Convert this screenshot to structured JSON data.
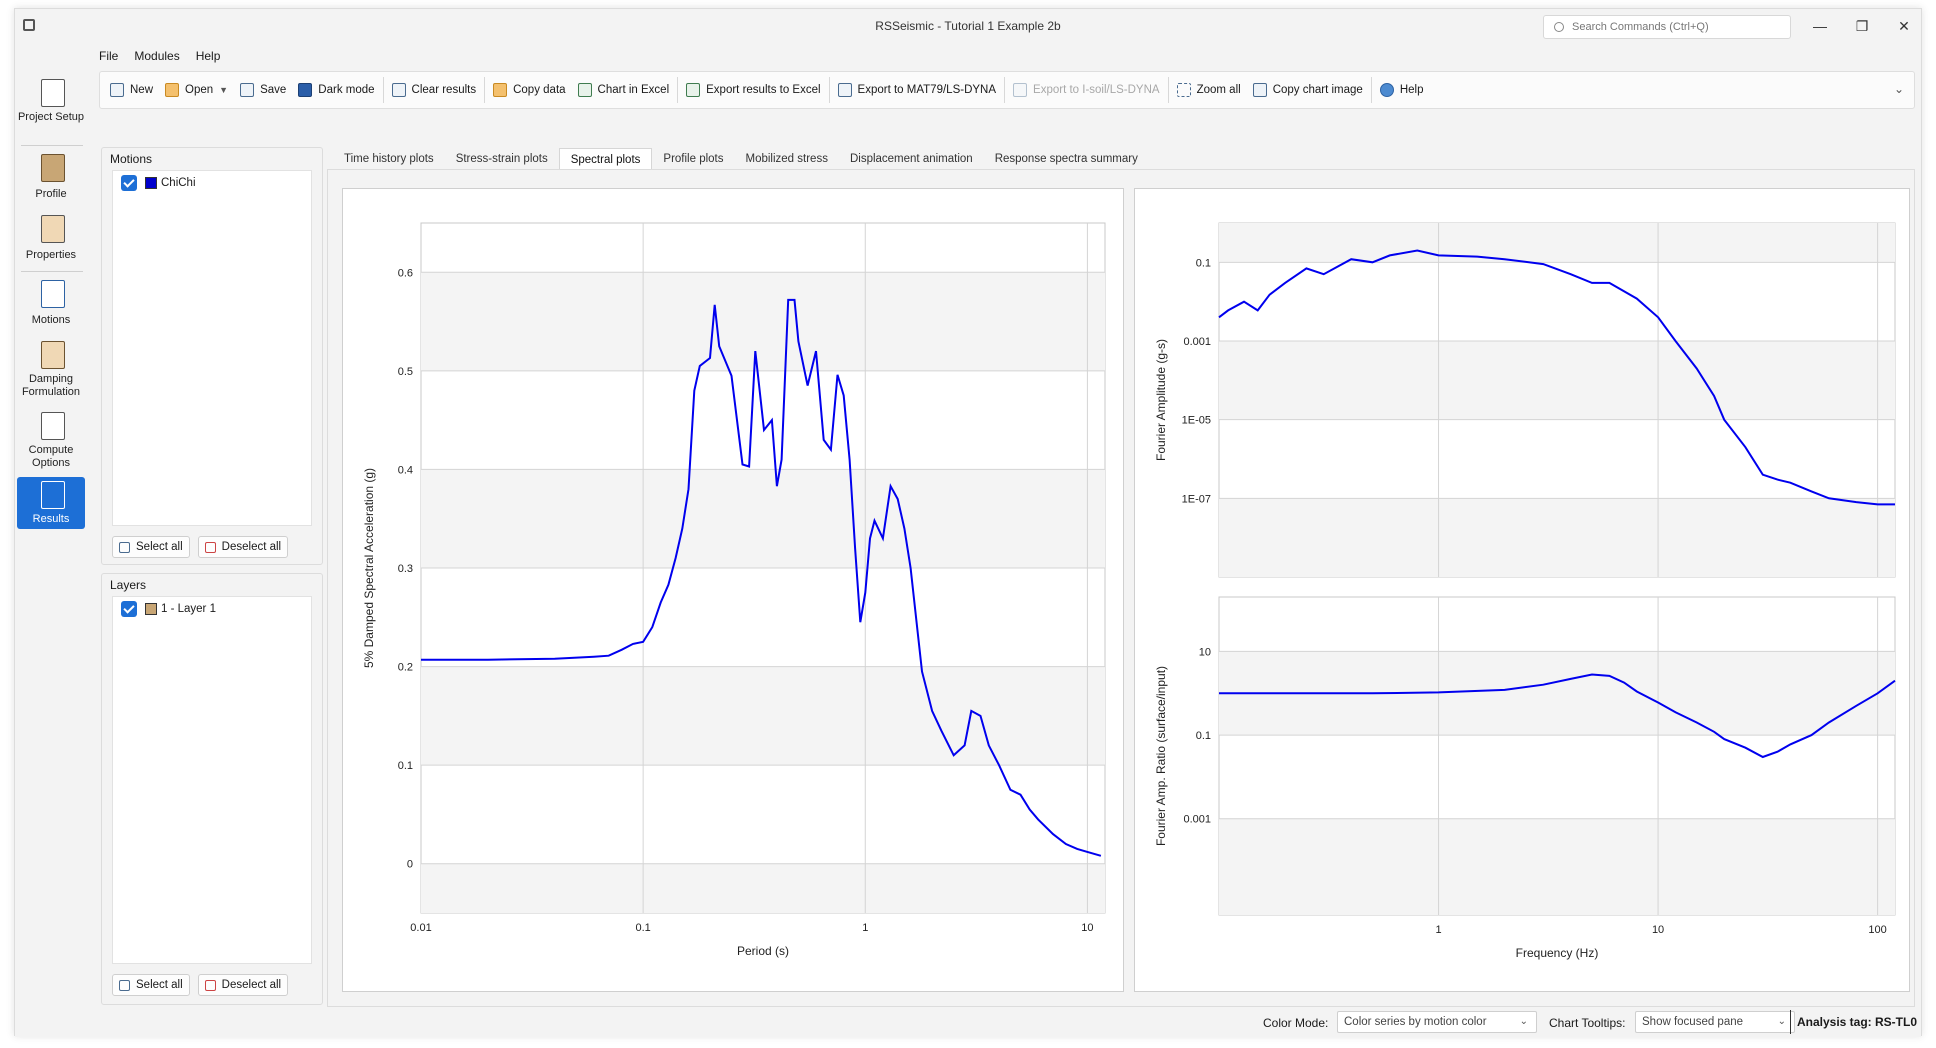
{
  "window": {
    "title": "RSSeismic - Tutorial 1 Example 2b",
    "search_placeholder": "Search Commands (Ctrl+Q)",
    "minimize": "—",
    "maximize": "❐",
    "close": "✕"
  },
  "menu": [
    "File",
    "Modules",
    "Help"
  ],
  "toolbar": [
    {
      "label": "New",
      "icon": "new-file-icon",
      "enabled": true
    },
    {
      "label": "Open",
      "icon": "open-folder-icon",
      "enabled": true,
      "dropdown": true
    },
    {
      "label": "Save",
      "icon": "save-icon",
      "enabled": true
    },
    {
      "label": "Dark mode",
      "icon": "dark-mode-icon",
      "enabled": true
    },
    {
      "label": "Clear results",
      "icon": "clear-results-icon",
      "enabled": true
    },
    {
      "label": "Copy data",
      "icon": "copy-data-icon",
      "enabled": true
    },
    {
      "label": "Chart in Excel",
      "icon": "chart-excel-icon",
      "enabled": true
    },
    {
      "label": "Export results to Excel",
      "icon": "export-excel-icon",
      "enabled": true
    },
    {
      "label": "Export to MAT79/LS-DYNA",
      "icon": "export-mat79-icon",
      "enabled": true
    },
    {
      "label": "Export to I-soil/LS-DYNA",
      "icon": "export-isoil-icon",
      "enabled": false
    },
    {
      "label": "Zoom all",
      "icon": "zoom-all-icon",
      "enabled": true
    },
    {
      "label": "Copy chart image",
      "icon": "copy-chart-image-icon",
      "enabled": true
    },
    {
      "label": "Help",
      "icon": "help-icon",
      "enabled": true
    }
  ],
  "rail": [
    {
      "label": "Project Setup",
      "icon": "project-setup-icon",
      "active": false
    },
    {
      "label": "Profile",
      "icon": "profile-icon",
      "active": false
    },
    {
      "label": "Properties",
      "icon": "properties-icon",
      "active": false
    },
    {
      "label": "Motions",
      "icon": "motions-icon",
      "active": false
    },
    {
      "label": "Damping Formulation",
      "icon": "damping-icon",
      "active": false
    },
    {
      "label": "Compute Options",
      "icon": "compute-icon",
      "active": false
    },
    {
      "label": "Results",
      "icon": "results-icon",
      "active": true
    }
  ],
  "motions_panel": {
    "title": "Motions",
    "items": [
      {
        "label": "ChiChi",
        "checked": true,
        "color": "#0000cc"
      }
    ],
    "select_all": "Select all",
    "deselect_all": "Deselect all"
  },
  "layers_panel": {
    "title": "Layers",
    "items": [
      {
        "label": "1 - Layer 1",
        "checked": true,
        "color": "#c8a675"
      }
    ],
    "select_all": "Select all",
    "deselect_all": "Deselect all"
  },
  "tabs": [
    {
      "label": "Time history plots",
      "active": false
    },
    {
      "label": "Stress-strain plots",
      "active": false
    },
    {
      "label": "Spectral plots",
      "active": true
    },
    {
      "label": "Profile plots",
      "active": false
    },
    {
      "label": "Mobilized stress",
      "active": false
    },
    {
      "label": "Displacement animation",
      "active": false
    },
    {
      "label": "Response spectra summary",
      "active": false
    }
  ],
  "status": {
    "color_mode_label": "Color Mode:",
    "color_mode_value": "Color series by motion color",
    "tooltips_label": "Chart Tooltips:",
    "tooltips_value": "Show focused pane",
    "analysis_tag": "Analysis tag: RS-TL0"
  },
  "chart_data": [
    {
      "type": "line",
      "xlabel": "Period (s)",
      "ylabel": "5% Damped Spectral Acceleration (g)",
      "xscale": "log",
      "xlim": [
        0.01,
        12
      ],
      "ylim": [
        -0.05,
        0.65
      ],
      "xticks": [
        "0.01",
        "0.1",
        "1",
        "10"
      ],
      "yticks": [
        "0",
        "0.1",
        "0.2",
        "0.3",
        "0.4",
        "0.5",
        "0.6"
      ],
      "color": "#0000ee",
      "series": [
        {
          "x": [
            0.01,
            0.02,
            0.04,
            0.06,
            0.07,
            0.08,
            0.09,
            0.1,
            0.11,
            0.12,
            0.13,
            0.14,
            0.15,
            0.16,
            0.17,
            0.18,
            0.2,
            0.21,
            0.22,
            0.25,
            0.28,
            0.3,
            0.32,
            0.35,
            0.38,
            0.4,
            0.42,
            0.45,
            0.48,
            0.5,
            0.55,
            0.6,
            0.65,
            0.7,
            0.75,
            0.8,
            0.85,
            0.9,
            0.95,
            1.0,
            1.05,
            1.1,
            1.2,
            1.3,
            1.4,
            1.5,
            1.6,
            1.8,
            2.0,
            2.2,
            2.5,
            2.8,
            3.0,
            3.3,
            3.6,
            4.0,
            4.5,
            5.0,
            5.5,
            6.0,
            7.0,
            8.0,
            9.0,
            10.0,
            11.5
          ],
          "y": [
            0.207,
            0.207,
            0.208,
            0.21,
            0.211,
            0.217,
            0.223,
            0.225,
            0.24,
            0.265,
            0.283,
            0.31,
            0.34,
            0.38,
            0.48,
            0.505,
            0.513,
            0.567,
            0.525,
            0.495,
            0.405,
            0.403,
            0.52,
            0.44,
            0.45,
            0.383,
            0.41,
            0.572,
            0.572,
            0.53,
            0.485,
            0.52,
            0.43,
            0.42,
            0.496,
            0.475,
            0.41,
            0.32,
            0.245,
            0.275,
            0.33,
            0.348,
            0.33,
            0.383,
            0.37,
            0.34,
            0.3,
            0.195,
            0.155,
            0.135,
            0.11,
            0.12,
            0.155,
            0.15,
            0.12,
            0.1,
            0.075,
            0.07,
            0.055,
            0.045,
            0.03,
            0.02,
            0.015,
            0.012,
            0.008
          ]
        }
      ]
    },
    {
      "type": "line",
      "xlabel": "",
      "ylabel": "Fourier Amplitude (g-s)",
      "xscale": "log",
      "yscale": "log",
      "xlim": [
        0.1,
        120
      ],
      "ylim": [
        1e-09,
        1
      ],
      "yticks": [
        "0.1",
        "0.001",
        "1E-05",
        "1E-07"
      ],
      "color": "#0000ee",
      "series": [
        {
          "x": [
            0.1,
            0.11,
            0.13,
            0.15,
            0.17,
            0.2,
            0.25,
            0.3,
            0.4,
            0.5,
            0.6,
            0.8,
            1.0,
            1.5,
            2.0,
            3.0,
            4.0,
            5.0,
            6.0,
            8.0,
            10.0,
            12.0,
            15.0,
            18.0,
            20.0,
            25.0,
            30.0,
            35.0,
            40.0,
            50.0,
            60.0,
            80.0,
            100.0,
            120.0
          ],
          "y": [
            0.004,
            0.006,
            0.01,
            0.006,
            0.015,
            0.03,
            0.07,
            0.05,
            0.12,
            0.1,
            0.15,
            0.2,
            0.15,
            0.14,
            0.12,
            0.09,
            0.05,
            0.03,
            0.03,
            0.012,
            0.004,
            0.001,
            0.0002,
            4e-05,
            1e-05,
            2e-06,
            4e-07,
            3e-07,
            2.5e-07,
            1.5e-07,
            1e-07,
            8e-08,
            7e-08,
            7e-08
          ]
        }
      ]
    },
    {
      "type": "line",
      "xlabel": "Frequency (Hz)",
      "ylabel": "Fourier Amp. Ratio (surface/input)",
      "xscale": "log",
      "yscale": "log",
      "xlim": [
        0.1,
        120
      ],
      "ylim": [
        5e-06,
        200
      ],
      "xticks": [
        "1",
        "10",
        "100"
      ],
      "yticks": [
        "10",
        "0.1",
        "0.001"
      ],
      "color": "#0000ee",
      "series": [
        {
          "x": [
            0.1,
            0.5,
            1.0,
            2.0,
            3.0,
            4.0,
            5.0,
            6.0,
            7.0,
            8.0,
            10.0,
            12.0,
            15.0,
            18.0,
            20.0,
            25.0,
            30.0,
            35.0,
            40.0,
            50.0,
            60.0,
            80.0,
            100.0,
            120.0
          ],
          "y": [
            1.0,
            1.0,
            1.05,
            1.2,
            1.6,
            2.2,
            2.8,
            2.6,
            1.8,
            1.1,
            0.6,
            0.35,
            0.2,
            0.12,
            0.08,
            0.05,
            0.03,
            0.04,
            0.06,
            0.1,
            0.2,
            0.5,
            1.0,
            2.0
          ]
        }
      ]
    }
  ]
}
